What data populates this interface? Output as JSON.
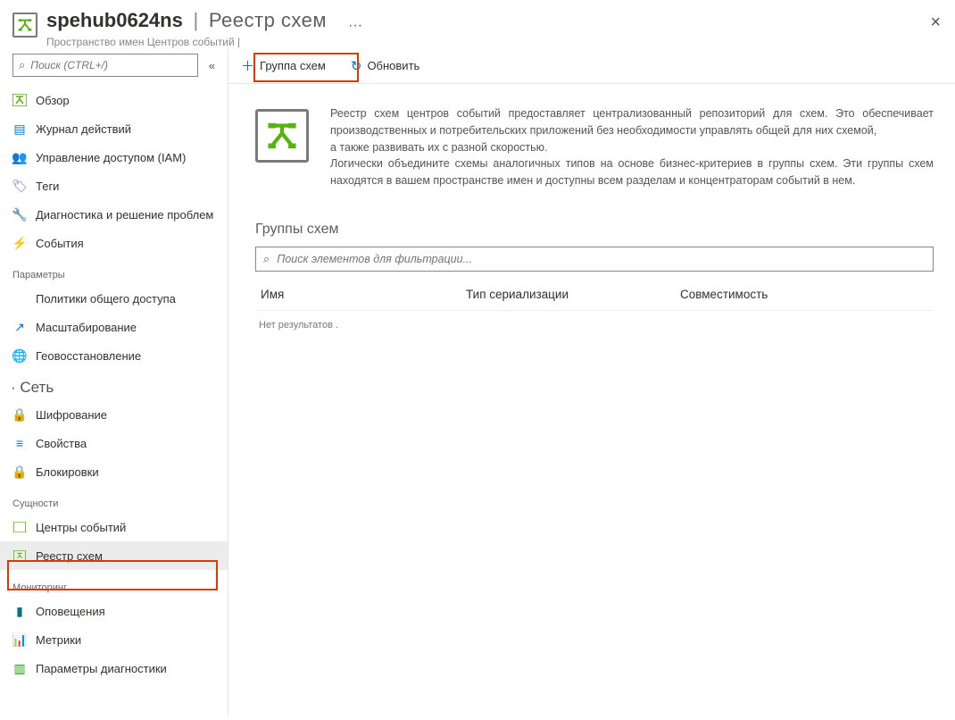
{
  "header": {
    "resource_name": "spehub0624ns",
    "page_title": "Реестр схем",
    "subtitle": "Пространство имен Центров событий |",
    "more": "···",
    "close": "×"
  },
  "sidebar": {
    "search_placeholder": "Поиск (CTRL+/)",
    "collapse": "«",
    "items_top": [
      {
        "label": "Обзор"
      },
      {
        "label": "Журнал действий"
      },
      {
        "label": "Управление доступом (IAM)"
      },
      {
        "label": "Теги"
      },
      {
        "label": "Диагностика и решение проблем"
      },
      {
        "label": "События"
      }
    ],
    "section_params": "Параметры",
    "items_params": [
      {
        "label": "Политики общего доступа"
      },
      {
        "label": "Масштабирование"
      },
      {
        "label": "Геовосстановление"
      }
    ],
    "section_network": "· Сеть",
    "items_network": [
      {
        "label": "Шифрование"
      },
      {
        "label": "Свойства"
      },
      {
        "label": "Блокировки"
      }
    ],
    "section_entities": "Сущности",
    "items_entities": [
      {
        "label": "Центры событий"
      },
      {
        "label": "Реестр схем"
      }
    ],
    "section_monitoring": "Мониторинг",
    "items_monitoring": [
      {
        "label": "Оповещения"
      },
      {
        "label": "Метрики"
      },
      {
        "label": "Параметры диагностики"
      }
    ]
  },
  "toolbar": {
    "add_group": "Группа схем",
    "refresh": "Обновить"
  },
  "content": {
    "intro_line1": "Реестр схем центров событий предоставляет централизованный репозиторий для схем. Это обеспечивает производственных и потребительских приложений без необходимости управлять общей для них схемой,",
    "intro_line2": "а также развивать их с разной скоростью.",
    "intro_line3": "Логически объедините схемы аналогичных типов на основе бизнес-критериев в группы схем. Эти группы схем находятся в вашем пространстве имен и доступны всем разделам и концентраторам событий в нем.",
    "groups_title": "Группы схем",
    "filter_placeholder": "Поиск элементов для фильтрации...",
    "col_name": "Имя",
    "col_type": "Тип сериализации",
    "col_compat": "Совместимость",
    "no_results": "Нет результатов ."
  }
}
